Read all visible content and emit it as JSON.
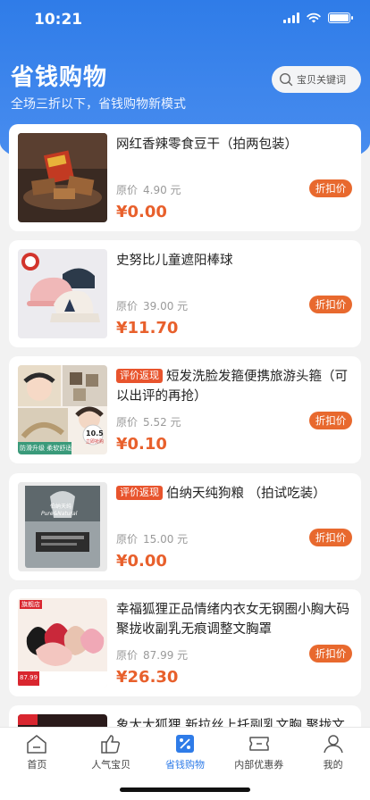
{
  "status": {
    "time": "10:21"
  },
  "header": {
    "title": "省钱购物",
    "subtitle": "全场三折以下，省钱购物新模式",
    "search_placeholder": "宝贝关键词"
  },
  "products": [
    {
      "title": "网红香辣零食豆干（拍两包装）",
      "tag": "",
      "orig_label": "原价",
      "orig_price": "4.90 元",
      "price": "¥0.00",
      "button": "折扣价"
    },
    {
      "title": "史努比儿童遮阳棒球",
      "tag": "",
      "orig_label": "原价",
      "orig_price": "39.00 元",
      "price": "¥11.70",
      "button": "折扣价"
    },
    {
      "title": "短发洗脸发箍便携旅游头箍（可以出评的再抢）",
      "tag": "评价返现",
      "orig_label": "原价",
      "orig_price": "5.52 元",
      "price": "¥0.10",
      "button": "折扣价",
      "thumb_text": [
        "防滑升级 柔软舒适",
        "10.5",
        "立即抢购"
      ]
    },
    {
      "title": "伯纳天纯狗粮 （拍试吃装）",
      "tag": "评价返现",
      "orig_label": "原价",
      "orig_price": "15.00 元",
      "price": "¥0.00",
      "button": "折扣价",
      "thumb_text": [
        "伯纳天纯",
        "Pure&Natural"
      ]
    },
    {
      "title": "幸福狐狸正品情绪内衣女无钢圈小胸大码聚拢收副乳无痕调整文胸罩",
      "tag": "",
      "orig_label": "原价",
      "orig_price": "87.99 元",
      "price": "¥26.30",
      "button": "折扣价",
      "thumb_text": [
        "旗舰店",
        "87.99"
      ]
    },
    {
      "title": "象大大狐狸 新拉丝上托副乳文胸 聚拢文型",
      "tag": "",
      "orig_label": "",
      "orig_price": "",
      "price": "",
      "button": ""
    }
  ],
  "tabbar": [
    {
      "label": "首页",
      "icon": "home-icon"
    },
    {
      "label": "人气宝贝",
      "icon": "thumbs-up-icon"
    },
    {
      "label": "省钱购物",
      "icon": "discount-icon",
      "active": true
    },
    {
      "label": "内部优惠券",
      "icon": "coupon-icon"
    },
    {
      "label": "我的",
      "icon": "profile-icon"
    }
  ],
  "colors": {
    "brand_blue": "#2f7ce8",
    "price_orange": "#e8602c",
    "tag_red": "#e8542d"
  }
}
